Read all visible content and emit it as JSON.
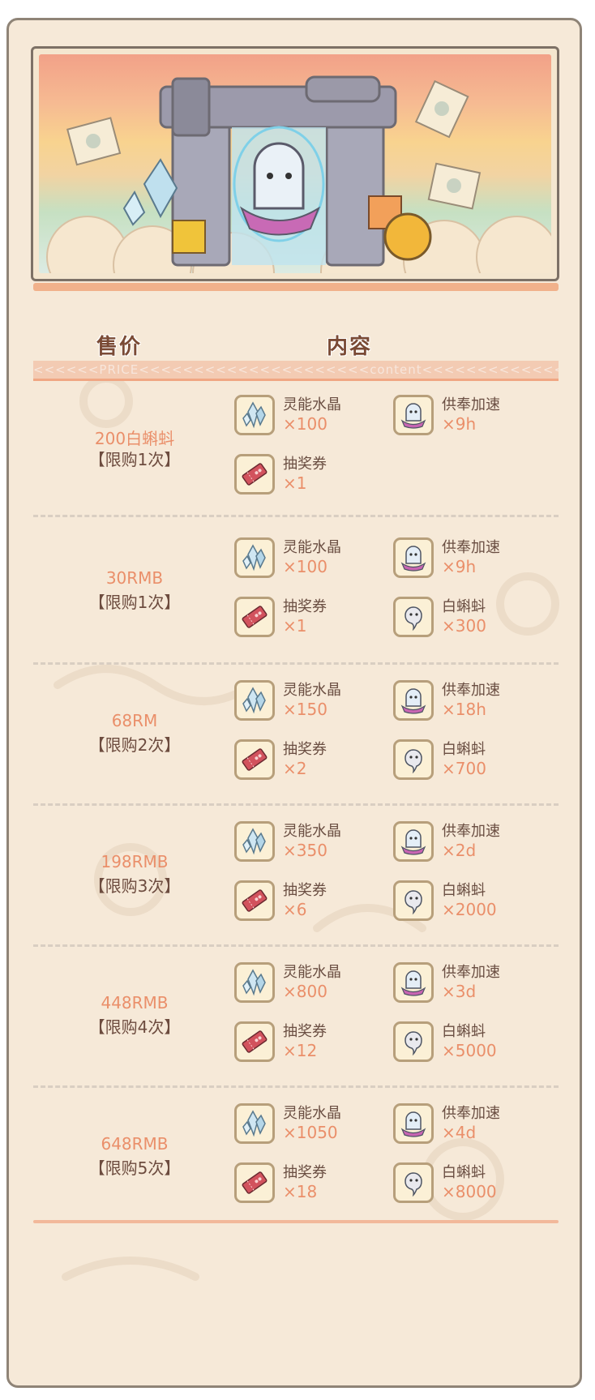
{
  "header": {
    "price_title": "售价",
    "content_title": "内容",
    "arrow_strip": "<<<<<<PRICE<<<<<<<<<<<<<<<<<<<<<content<<<<<<<<<<<<<<<"
  },
  "packages": [
    {
      "price": "200白蝌蚪",
      "limit": "【限购1次】",
      "items": [
        {
          "name": "灵能水晶",
          "qty": "×100",
          "icon": "crystal-icon"
        },
        {
          "name": "供奉加速",
          "qty": "×9h",
          "icon": "ghost-icon"
        },
        {
          "name": "抽奖券",
          "qty": "×1",
          "icon": "ticket-icon"
        }
      ]
    },
    {
      "price": "30RMB",
      "limit": "【限购1次】",
      "items": [
        {
          "name": "灵能水晶",
          "qty": "×100",
          "icon": "crystal-icon"
        },
        {
          "name": "供奉加速",
          "qty": "×9h",
          "icon": "ghost-icon"
        },
        {
          "name": "抽奖券",
          "qty": "×1",
          "icon": "ticket-icon"
        },
        {
          "name": "白蝌蚪",
          "qty": "×300",
          "icon": "tadpole-icon"
        }
      ]
    },
    {
      "price": "68RM",
      "limit": "【限购2次】",
      "items": [
        {
          "name": "灵能水晶",
          "qty": "×150",
          "icon": "crystal-icon"
        },
        {
          "name": "供奉加速",
          "qty": "×18h",
          "icon": "ghost-icon"
        },
        {
          "name": "抽奖券",
          "qty": "×2",
          "icon": "ticket-icon"
        },
        {
          "name": "白蝌蚪",
          "qty": "×700",
          "icon": "tadpole-icon"
        }
      ]
    },
    {
      "price": "198RMB",
      "limit": "【限购3次】",
      "items": [
        {
          "name": "灵能水晶",
          "qty": "×350",
          "icon": "crystal-icon"
        },
        {
          "name": "供奉加速",
          "qty": "×2d",
          "icon": "ghost-icon"
        },
        {
          "name": "抽奖券",
          "qty": "×6",
          "icon": "ticket-icon"
        },
        {
          "name": "白蝌蚪",
          "qty": "×2000",
          "icon": "tadpole-icon"
        }
      ]
    },
    {
      "price": "448RMB",
      "limit": "【限购4次】",
      "items": [
        {
          "name": "灵能水晶",
          "qty": "×800",
          "icon": "crystal-icon"
        },
        {
          "name": "供奉加速",
          "qty": "×3d",
          "icon": "ghost-icon"
        },
        {
          "name": "抽奖券",
          "qty": "×12",
          "icon": "ticket-icon"
        },
        {
          "name": "白蝌蚪",
          "qty": "×5000",
          "icon": "tadpole-icon"
        }
      ]
    },
    {
      "price": "648RMB",
      "limit": "【限购5次】",
      "items": [
        {
          "name": "灵能水晶",
          "qty": "×1050",
          "icon": "crystal-icon"
        },
        {
          "name": "供奉加速",
          "qty": "×4d",
          "icon": "ghost-icon"
        },
        {
          "name": "抽奖券",
          "qty": "×18",
          "icon": "ticket-icon"
        },
        {
          "name": "白蝌蚪",
          "qty": "×8000",
          "icon": "tadpole-icon"
        }
      ]
    }
  ],
  "colors": {
    "accent": "#ea8f6a",
    "text": "#6a4e42",
    "background": "#f6e9d8",
    "border": "#8f8477"
  }
}
